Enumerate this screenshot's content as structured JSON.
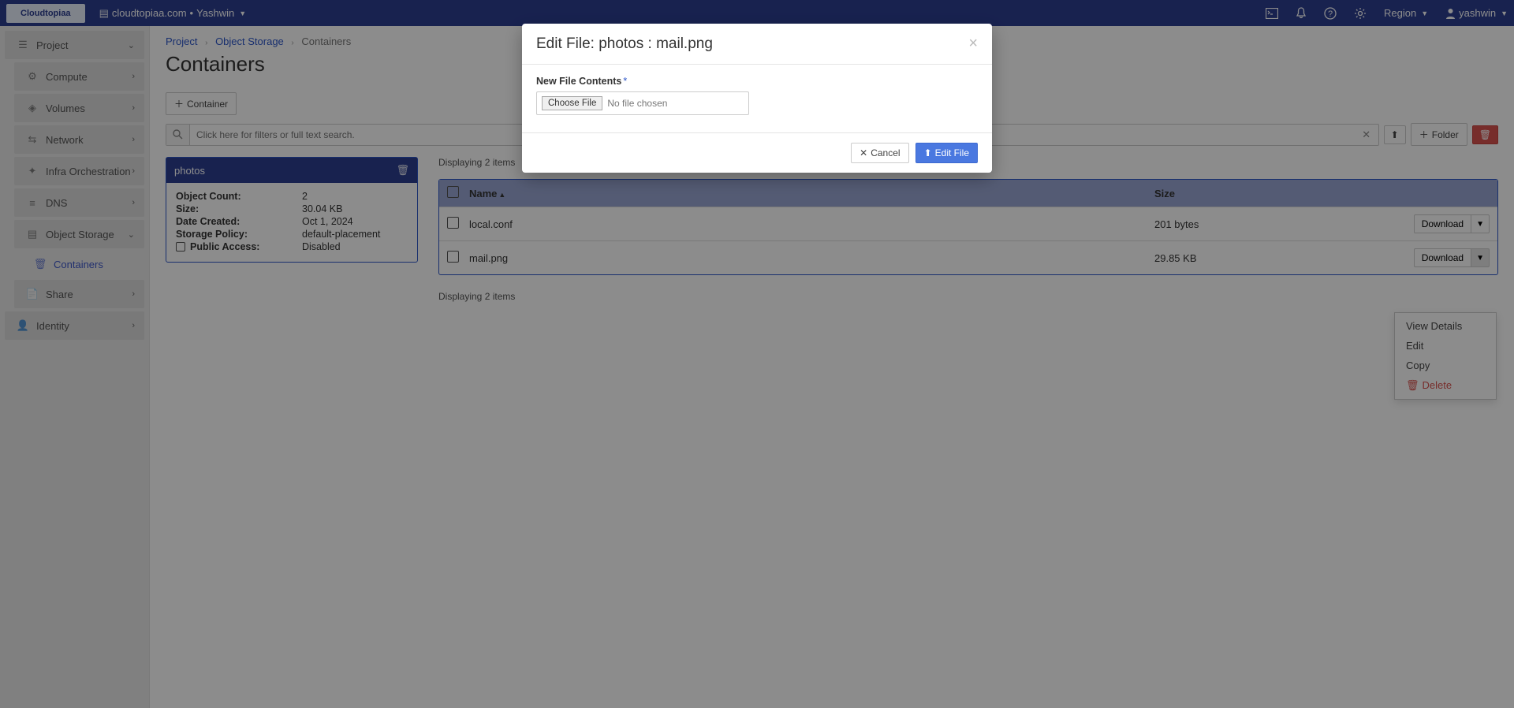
{
  "brand": "Cloudtopiaa",
  "context": {
    "domain": "cloudtopiaa.com",
    "project": "Yashwin"
  },
  "topbar": {
    "region_label": "Region",
    "user": "yashwin"
  },
  "sidebar": {
    "groups": [
      {
        "label": "Project",
        "expanded": true
      },
      {
        "label": "Identity",
        "expanded": false
      }
    ],
    "project_items": [
      {
        "label": "Compute"
      },
      {
        "label": "Volumes"
      },
      {
        "label": "Network"
      },
      {
        "label": "Infra Orchestration"
      },
      {
        "label": "DNS"
      },
      {
        "label": "Object Storage",
        "expanded": true,
        "sub": [
          {
            "label": "Containers",
            "active": true
          }
        ]
      },
      {
        "label": "Share"
      }
    ]
  },
  "breadcrumb": {
    "items": [
      "Project",
      "Object Storage",
      "Containers"
    ]
  },
  "page_title": "Containers",
  "buttons": {
    "add_container": "Container",
    "add_folder": "Folder"
  },
  "search": {
    "placeholder": "Click here for filters or full text search."
  },
  "selected_container": {
    "name": "photos",
    "fields": {
      "object_count_label": "Object Count:",
      "object_count": "2",
      "size_label": "Size:",
      "size": "30.04 KB",
      "date_created_label": "Date Created:",
      "date_created": "Oct 1, 2024",
      "storage_policy_label": "Storage Policy:",
      "storage_policy": "default-placement",
      "public_access_label": "Public Access:",
      "public_access": "Disabled"
    }
  },
  "objects": {
    "count_text_top": "Displaying 2 items",
    "count_text_bottom": "Displaying 2 items",
    "columns": {
      "name": "Name",
      "size": "Size"
    },
    "rows": [
      {
        "name": "local.conf",
        "size": "201 bytes",
        "action": "Download"
      },
      {
        "name": "mail.png",
        "size": "29.85 KB",
        "action": "Download"
      }
    ],
    "row_menu": {
      "view": "View Details",
      "edit": "Edit",
      "copy": "Copy",
      "delete": "Delete"
    }
  },
  "modal": {
    "title": "Edit File: photos : mail.png",
    "field_label": "New File Contents",
    "choose_file": "Choose File",
    "no_file": "No file chosen",
    "cancel": "Cancel",
    "submit": "Edit File"
  }
}
